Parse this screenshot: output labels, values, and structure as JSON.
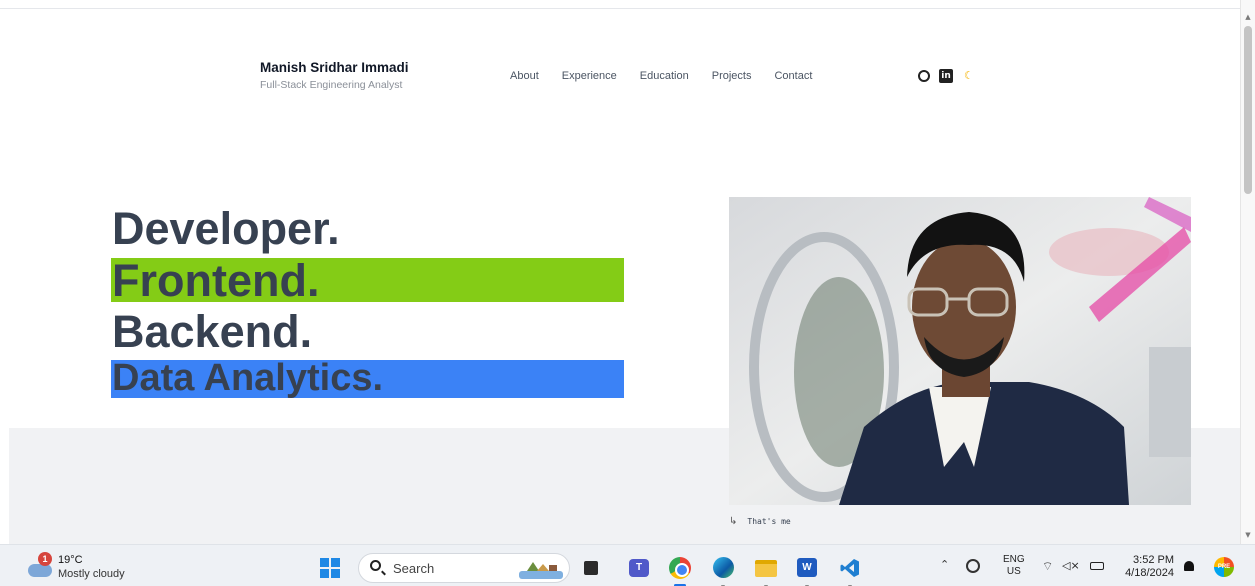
{
  "header": {
    "name": "Manish Sridhar Immadi",
    "subtitle": "Full-Stack Engineering Analyst",
    "nav": [
      "About",
      "Experience",
      "Education",
      "Projects",
      "Contact"
    ],
    "icons": [
      "github-icon",
      "linkedin-icon",
      "moon-icon"
    ]
  },
  "hero": {
    "line1": "Developer.",
    "line2": "Frontend.",
    "line3": "Backend.",
    "line4": "Data Analytics.",
    "highlight_colors": {
      "frontend": "#84cc16",
      "data_analytics": "#3b82f6"
    },
    "text_color": "#374151",
    "photo_caption": "That's me",
    "caption_icon": "return-arrow-icon"
  },
  "taskbar": {
    "weather": {
      "temp": "19°C",
      "condition": "Mostly cloudy",
      "badge": "1"
    },
    "search_label": "Search",
    "apps": [
      "start-icon",
      "file-explorer-icon",
      "teams-icon",
      "chrome-icon",
      "edge-icon",
      "folder-icon",
      "word-icon",
      "vscode-icon"
    ],
    "language": {
      "primary": "ENG",
      "region": "US"
    },
    "time": "3:52 PM",
    "date": "4/18/2024",
    "pre_badge": "PRE"
  }
}
